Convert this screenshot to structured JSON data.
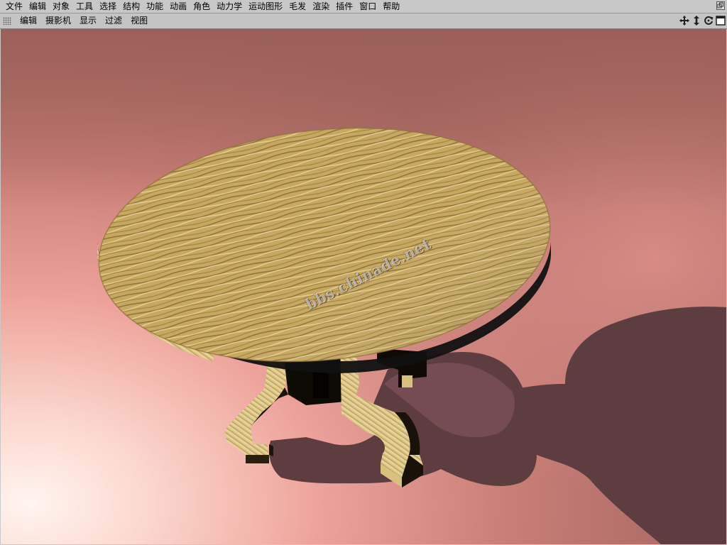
{
  "menubar": {
    "items": [
      "文件",
      "编辑",
      "对象",
      "工具",
      "选择",
      "结构",
      "功能",
      "动画",
      "角色",
      "动力学",
      "运动图形",
      "毛发",
      "渲染",
      "插件",
      "窗口",
      "帮助"
    ]
  },
  "viewport_toolbar": {
    "items": [
      "编辑",
      "摄影机",
      "显示",
      "过滤",
      "视图"
    ],
    "nav_icons": [
      "move-icon",
      "dolly-icon",
      "rotate-icon",
      "maximize-icon"
    ]
  },
  "scene": {
    "subject": "round-wooden-table",
    "watermark": "bbs.chinade.net",
    "colors": {
      "background_dark": "#a66862",
      "floor_light": "#fbe3dd",
      "wood": "#c8a860",
      "shadow": "#5d3d3f"
    }
  }
}
